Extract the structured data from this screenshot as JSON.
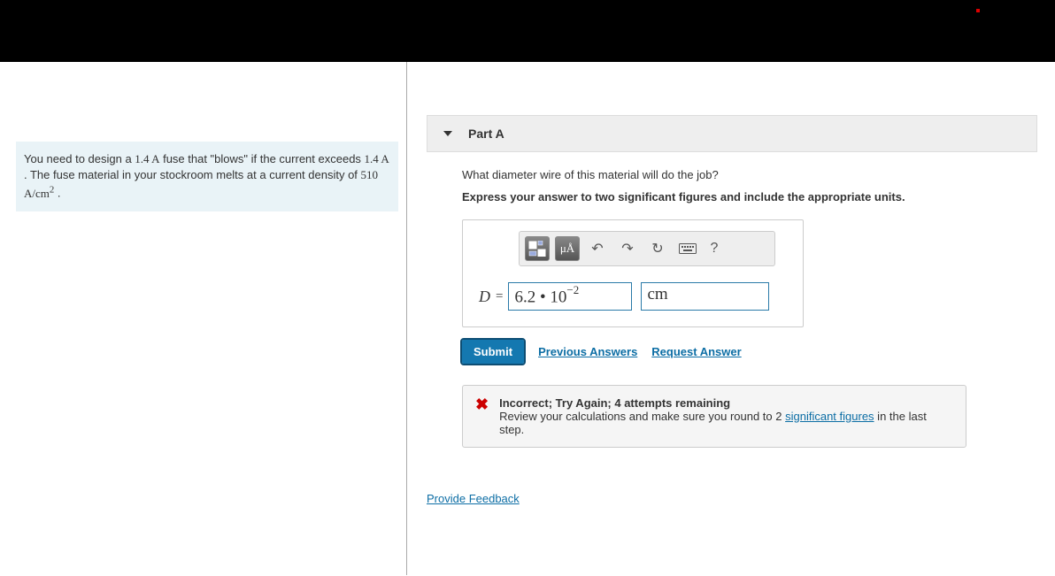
{
  "problem": {
    "text_a": "You need to design a ",
    "val1": "1.4 A",
    "text_b": " fuse that \"blows\" if the current exceeds ",
    "val2": "1.4 A",
    "text_c": " . The fuse material in your stockroom melts at a current density of ",
    "val3": "510 A/cm",
    "val3_exp": "2",
    "text_d": " ."
  },
  "part": {
    "label": "Part A",
    "question": "What diameter wire of this material will do the job?",
    "instruction": "Express your answer to two significant figures and include the appropriate units."
  },
  "toolbar": {
    "templates": "templates",
    "symbols": "μÅ",
    "undo": "↶",
    "redo": "↷",
    "reset": "↻",
    "keyboard": "⌨",
    "help": "?"
  },
  "answer": {
    "var": "D",
    "eq": "=",
    "value": "6.2 • 10",
    "value_exp": "−2",
    "unit": "cm"
  },
  "actions": {
    "submit": "Submit",
    "previous": "Previous Answers",
    "request": "Request Answer"
  },
  "feedback": {
    "title": "Incorrect; Try Again; 4 attempts remaining",
    "line_a": "Review your calculations and make sure you round to 2 ",
    "siglink": "significant figures",
    "line_b": " in the last step."
  },
  "footer": {
    "provide": "Provide Feedback"
  }
}
